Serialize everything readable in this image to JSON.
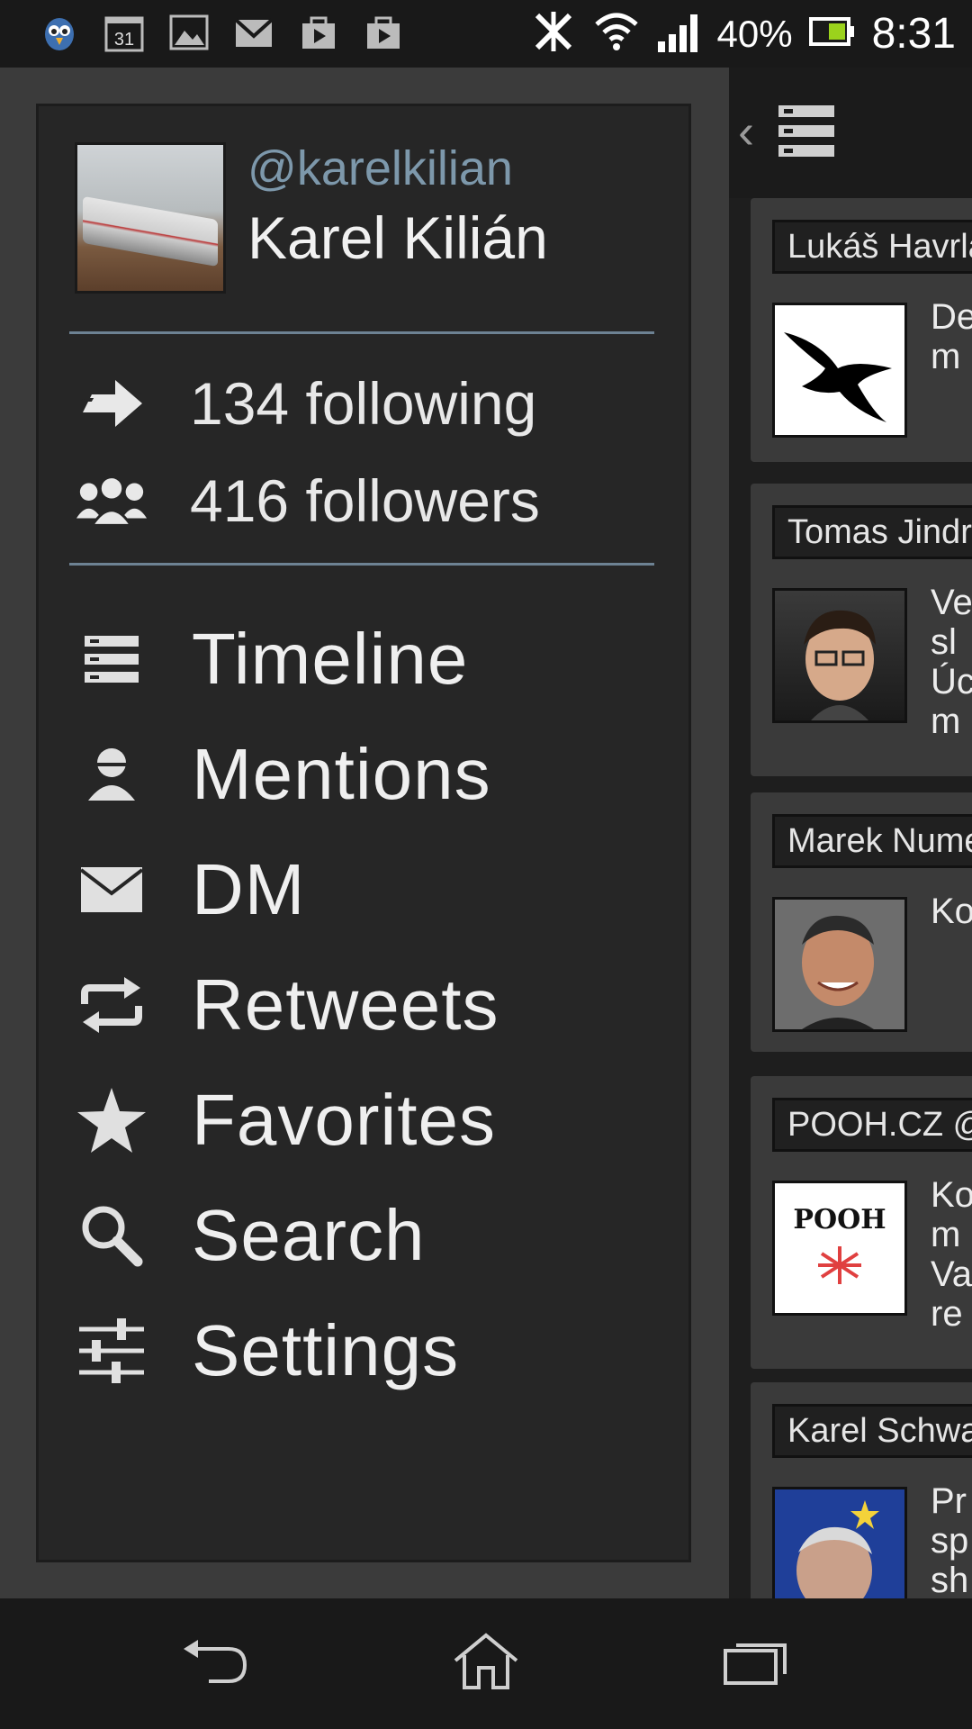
{
  "status_bar": {
    "battery": "40%",
    "time": "8:31",
    "calendar_day": "31"
  },
  "profile": {
    "handle": "@karelkilian",
    "name": "Karel Kilián",
    "following": "134 following",
    "followers": "416 followers"
  },
  "menu": {
    "timeline": "Timeline",
    "mentions": "Mentions",
    "dm": "DM",
    "retweets": "Retweets",
    "favorites": "Favorites",
    "search": "Search",
    "settings": "Settings"
  },
  "timeline": {
    "back_glyph": "‹",
    "tweets": [
      {
        "name": "Lukáš Havrla",
        "text": "De\nm"
      },
      {
        "name": "Tomas Jindra",
        "text": "Ve\nsl\nÚc\nm"
      },
      {
        "name": "Marek Numer",
        "text": "Ko"
      },
      {
        "name": "POOH.CZ @",
        "text": "Ko\nm\nVa\nre"
      },
      {
        "name": "Karel Schwa",
        "text": "Pr\nsp\nsh"
      }
    ],
    "pooh_logo_text": "POOH"
  },
  "colors": {
    "accent": "#7d98ab",
    "divider": "#6d8293"
  }
}
